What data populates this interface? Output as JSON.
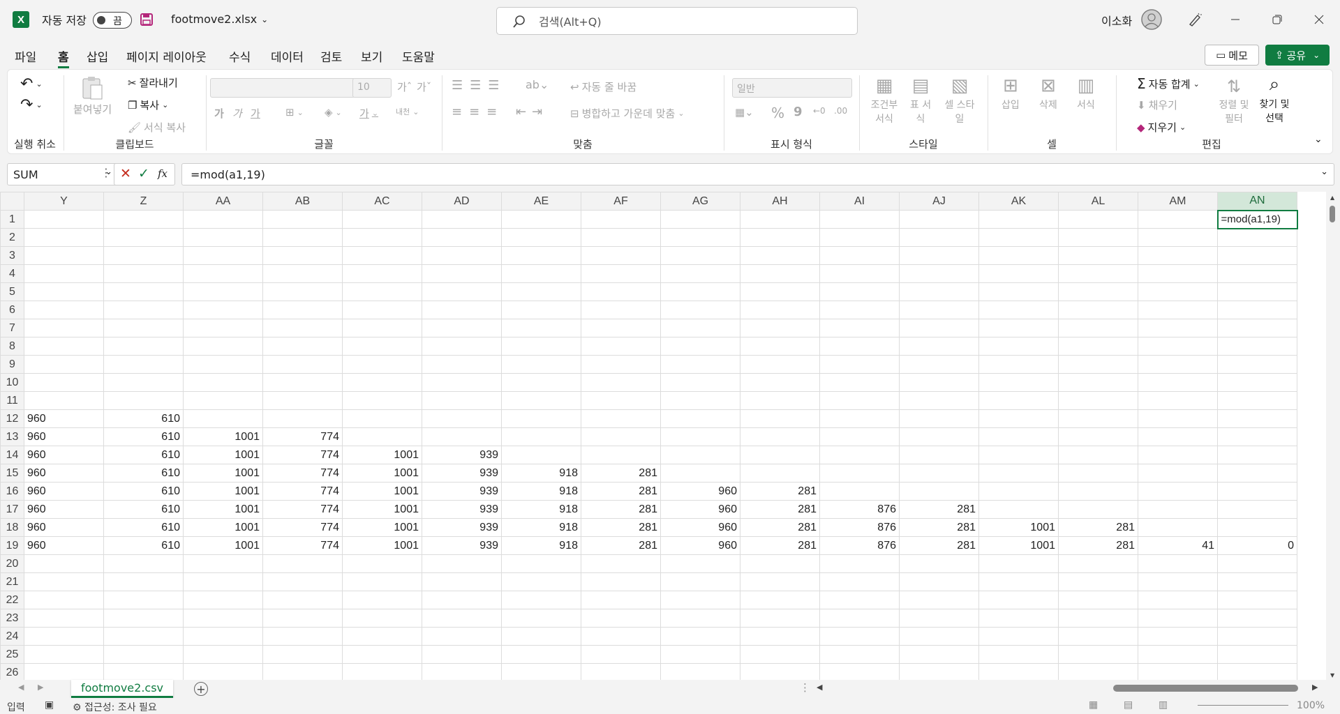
{
  "title_bar": {
    "app_icon": "excel-logo",
    "autosave_label": "자동 저장",
    "autosave_state": "끔",
    "filename": "footmove2.xlsx",
    "search_placeholder": "검색(Alt+Q)",
    "user_name": "이소화"
  },
  "menu": [
    "파일",
    "홈",
    "삽입",
    "페이지 레이아웃",
    "수식",
    "데이터",
    "검토",
    "보기",
    "도움말"
  ],
  "menu_active": "홈",
  "actions": {
    "memo": "메모",
    "share": "공유"
  },
  "ribbon": {
    "undo_group": "실행 취소",
    "clipboard": {
      "label": "클립보드",
      "paste": "붙여넣기",
      "cut": "잘라내기",
      "copy": "복사",
      "format_painter": "서식 복사"
    },
    "font": {
      "label": "글꼴",
      "size": "10",
      "grow": "가ˆ",
      "shrink": "가ˇ",
      "bold": "가",
      "italic": "가",
      "underline": "가",
      "color_glyph": "가",
      "phonetic": "내천"
    },
    "alignment": {
      "label": "맞춤",
      "wrap": "자동 줄 바꿈",
      "merge": "병합하고 가운데 맞춤"
    },
    "number": {
      "label": "표시 형식",
      "format": "일반",
      "percent": "%",
      "comma": "9"
    },
    "styles": {
      "label": "스타일",
      "conditional": "조건부 서식",
      "table": "표 서식",
      "cell_styles": "셀 스타일"
    },
    "cells": {
      "label": "셀",
      "insert": "삽입",
      "delete": "삭제",
      "format": "서식"
    },
    "editing": {
      "label": "편집",
      "autosum": "자동 합계",
      "fill": "채우기",
      "clear": "지우기",
      "sort_filter": "정렬 및 필터",
      "find_select": "찾기 및 선택"
    }
  },
  "formula_bar": {
    "name_box": "SUM",
    "formula": "=mod(a1,19)"
  },
  "grid": {
    "columns": [
      "",
      "Y",
      "Z",
      "AA",
      "AB",
      "AC",
      "AD",
      "AE",
      "AF",
      "AG",
      "AH",
      "AI",
      "AJ",
      "AK",
      "AL",
      "AM",
      "AN"
    ],
    "selected_column": "AN",
    "active_cell_text": "=mod(a1,19)",
    "rows": [
      {
        "n": "1",
        "cells": []
      },
      {
        "n": "2",
        "cells": []
      },
      {
        "n": "3",
        "cells": []
      },
      {
        "n": "4",
        "cells": []
      },
      {
        "n": "5",
        "cells": []
      },
      {
        "n": "6",
        "cells": []
      },
      {
        "n": "7",
        "cells": []
      },
      {
        "n": "8",
        "cells": []
      },
      {
        "n": "9",
        "cells": []
      },
      {
        "n": "10",
        "cells": []
      },
      {
        "n": "11",
        "cells": []
      },
      {
        "n": "12",
        "cells": [
          "960",
          "610"
        ]
      },
      {
        "n": "13",
        "cells": [
          "960",
          "610",
          "1001",
          "774"
        ]
      },
      {
        "n": "14",
        "cells": [
          "960",
          "610",
          "1001",
          "774",
          "1001",
          "939"
        ]
      },
      {
        "n": "15",
        "cells": [
          "960",
          "610",
          "1001",
          "774",
          "1001",
          "939",
          "918",
          "281"
        ]
      },
      {
        "n": "16",
        "cells": [
          "960",
          "610",
          "1001",
          "774",
          "1001",
          "939",
          "918",
          "281",
          "960",
          "281"
        ]
      },
      {
        "n": "17",
        "cells": [
          "960",
          "610",
          "1001",
          "774",
          "1001",
          "939",
          "918",
          "281",
          "960",
          "281",
          "876",
          "281"
        ]
      },
      {
        "n": "18",
        "cells": [
          "960",
          "610",
          "1001",
          "774",
          "1001",
          "939",
          "918",
          "281",
          "960",
          "281",
          "876",
          "281",
          "1001",
          "281"
        ]
      },
      {
        "n": "19",
        "cells": [
          "960",
          "610",
          "1001",
          "774",
          "1001",
          "939",
          "918",
          "281",
          "960",
          "281",
          "876",
          "281",
          "1001",
          "281",
          "41",
          "0"
        ]
      },
      {
        "n": "20",
        "cells": []
      },
      {
        "n": "21",
        "cells": []
      },
      {
        "n": "22",
        "cells": []
      },
      {
        "n": "23",
        "cells": []
      },
      {
        "n": "24",
        "cells": []
      },
      {
        "n": "25",
        "cells": []
      },
      {
        "n": "26",
        "cells": []
      }
    ]
  },
  "sheet_tab": "footmove2.csv",
  "status": {
    "mode": "입력",
    "accessibility": "접근성: 조사 필요",
    "zoom": "100%"
  },
  "colors": {
    "accent": "#107c41",
    "selected_header": "#d3e7d9"
  }
}
